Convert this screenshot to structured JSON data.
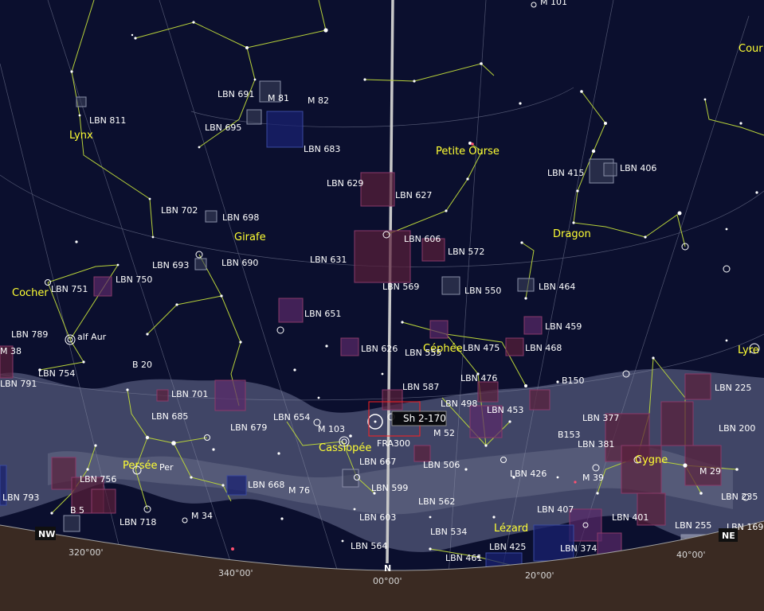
{
  "colors": {
    "sky": "#0b0f2e",
    "ground": "#3a2a22",
    "constellation_line": "#b8d23a",
    "grid": "#8a8fa8",
    "meridian": "#c8c8c8",
    "constellation_label": "#ffff33",
    "label": "#ffffff",
    "nebula_dark": "#5a1f3a",
    "nebula_blue": "#1a2270",
    "milkyway": "#4a4f70",
    "selection": "#ff2020"
  },
  "constellations": [
    "Lynx",
    "Girafe",
    "Petite Ourse",
    "Dragon",
    "Cocher",
    "Cassiopée",
    "Céphée",
    "Persée",
    "Lézard",
    "Cygne",
    "Lyre",
    "Cour"
  ],
  "objects": [
    "LBN 811",
    "LBN 691",
    "M 81",
    "M 82",
    "LBN 695",
    "LBN 683",
    "LBN 629",
    "LBN 627",
    "LBN 702",
    "LBN 698",
    "LBN 693",
    "LBN 690",
    "LBN 631",
    "LBN 606",
    "LBN 572",
    "LBN 569",
    "LBN 550",
    "LBN 464",
    "LBN 415",
    "LBN 406",
    "LBN 751",
    "LBN 750",
    "LBN 651",
    "LBN 789",
    "alf Aur",
    "M 38",
    "LBN 754",
    "B 20",
    "LBN 791",
    "LBN 626",
    "LBN 555",
    "LBN 475",
    "LBN 468",
    "LBN 459",
    "LBN 701",
    "LBN 587",
    "LBN 476",
    "B150",
    "LBN 225",
    "LBN 685",
    "LBN 654",
    "LBN 498",
    "LBN 453",
    "LBN 377",
    "LBN 679",
    "M 103",
    "M 52",
    "B153",
    "LBN 200",
    "LBN 381",
    "LBN 667",
    "LBN 506",
    "LBN 756",
    "Per",
    "LBN 426",
    "M 39",
    "M 29",
    "LBN 793",
    "LBN 668",
    "M 76",
    "LBN 599",
    "LBN 562",
    "LBN 235",
    "B 5",
    "LBN 718",
    "M 34",
    "LBN 603",
    "LBN 407",
    "LBN 401",
    "LBN 534",
    "LBN 255",
    "LBN 169",
    "LBN 564",
    "LBN 425",
    "LBN 374",
    "LBN 461",
    "M 101",
    "FRA300"
  ],
  "selection": {
    "name": "Sh 2-170"
  },
  "horizon": {
    "cardinals": [
      "NW",
      "N",
      "NE"
    ],
    "azimuths": [
      "320°00'",
      "340°00'",
      "00°00'",
      "20°00'",
      "40°00'"
    ]
  }
}
